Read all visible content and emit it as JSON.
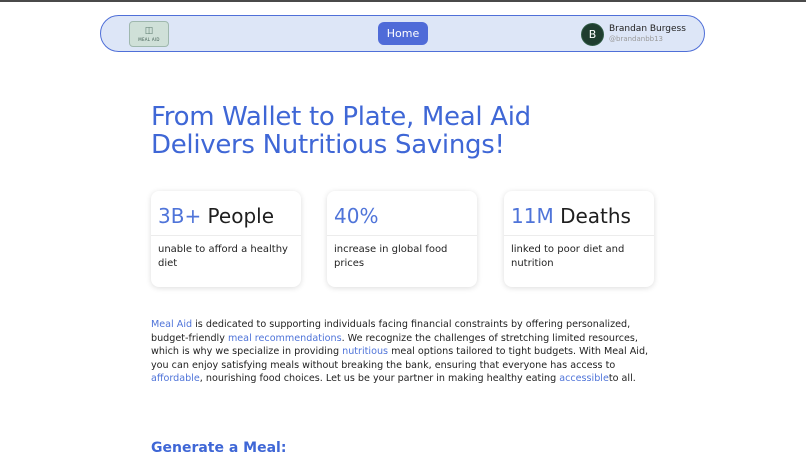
{
  "nav": {
    "logo_text": "MEAL AID",
    "home_label": "Home",
    "user": {
      "initial": "B",
      "name": "Brandan Burgess",
      "handle": "@brandanbb13"
    }
  },
  "hero": {
    "line1": "From Wallet to Plate, Meal Aid",
    "line2": "Delivers Nutritious Savings!"
  },
  "stats": [
    {
      "number": "3B+",
      "word": " People",
      "desc": "unable to afford a healthy diet"
    },
    {
      "number": "40%",
      "word": "",
      "desc": "increase in global food prices"
    },
    {
      "number": "11M",
      "word": " Deaths",
      "desc": "linked to poor diet and nutrition"
    }
  ],
  "paragraph": {
    "s1": "Meal Aid",
    "s2": " is dedicated to supporting individuals facing financial constraints by offering personalized, budget-friendly ",
    "s3": "meal recommendations",
    "s4": ". We recognize the challenges of stretching limited resources, which is why we specialize in providing ",
    "s5": "nutritious",
    "s6": " meal options tailored to tight budgets. With Meal Aid, you can enjoy satisfying meals without breaking the bank, ensuring that everyone has access to ",
    "s7": "affordable",
    "s8": ", nourishing food choices. Let us be your partner in making healthy eating ",
    "s9": "accessible",
    "s10": "to all."
  },
  "generate": {
    "title": "Generate a Meal:"
  },
  "colors": {
    "accent": "#4f6bd8",
    "heading_blue": "#3f67d6",
    "nav_bg": "#dde6f7",
    "avatar_bg": "#1f3d2f"
  }
}
